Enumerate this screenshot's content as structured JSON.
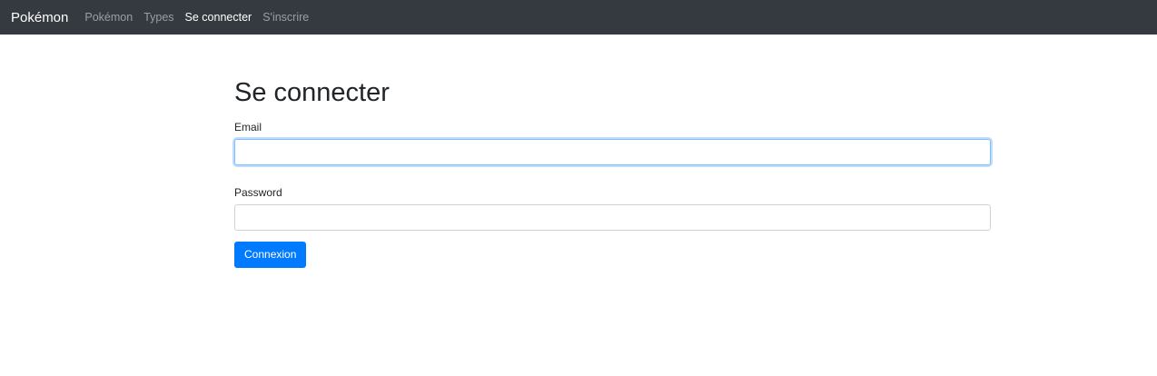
{
  "navbar": {
    "brand": "Pokémon",
    "links": [
      {
        "label": "Pokémon",
        "active": false
      },
      {
        "label": "Types",
        "active": false
      },
      {
        "label": "Se connecter",
        "active": true
      },
      {
        "label": "S'inscrire",
        "active": false
      }
    ]
  },
  "login": {
    "title": "Se connecter",
    "email_label": "Email",
    "email_value": "",
    "password_label": "Password",
    "password_value": "",
    "submit_label": "Connexion"
  },
  "colors": {
    "navbar_bg": "#343a40",
    "primary": "#007bff",
    "focus_border": "#80bdff"
  }
}
